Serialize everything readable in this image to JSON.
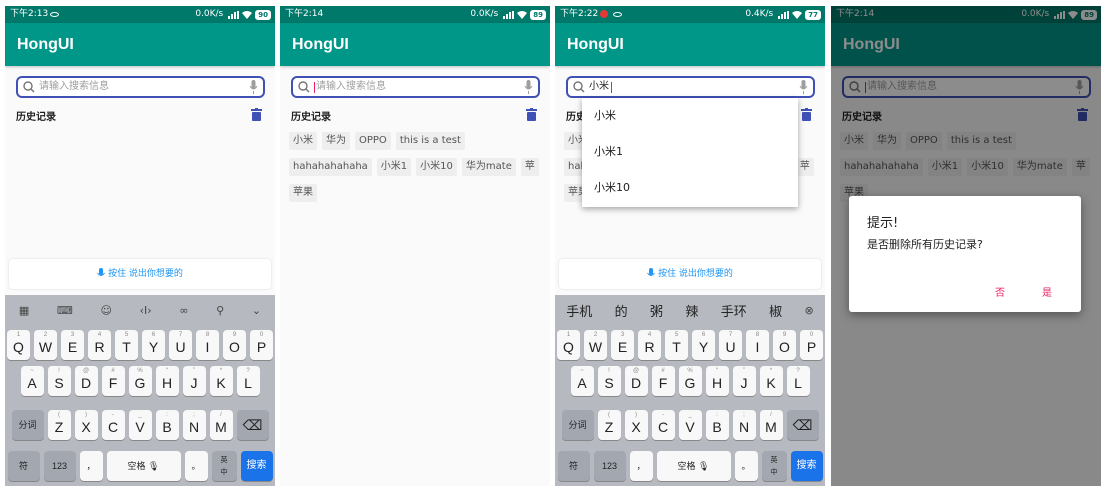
{
  "colors": {
    "primary_dark": "#00796b",
    "primary": "#009688",
    "accent": "#e91e63",
    "search_border": "#3f51b5",
    "keyboard_enter": "#1a73e8"
  },
  "screens": [
    {
      "status": {
        "time": "下午2:13",
        "net": "0.0K/s",
        "battery": "90"
      },
      "title": "HongUI",
      "search": {
        "placeholder": "请输入搜索信息",
        "value": ""
      },
      "history_title": "历史记录",
      "voice": "按住 说出你想要的",
      "keyboard_toolbar": [
        "grid-icon",
        "keyboard-icon",
        "emoji-icon",
        "cursor-icon",
        "link-icon",
        "search-icon",
        "chevron-down-icon"
      ]
    },
    {
      "status": {
        "time": "下午2:14",
        "net": "0.0K/s",
        "battery": "89"
      },
      "title": "HongUI",
      "search": {
        "placeholder": "请输入搜索信息",
        "value": ""
      },
      "history_title": "历史记录",
      "tags": [
        "小米",
        "华为",
        "OPPO",
        "this is a test",
        "hahahahahaha",
        "小米1",
        "小米10",
        "华为mate",
        "苹",
        "苹果"
      ]
    },
    {
      "status": {
        "time": "下午2:22",
        "net": "0.4K/s",
        "battery": "77"
      },
      "title": "HongUI",
      "search": {
        "placeholder": "请输入搜索信息",
        "value": "小米"
      },
      "history_title": "历史记录",
      "suggestions": [
        "小米",
        "小米1",
        "小米10"
      ],
      "voice": "按住 说出你想要的",
      "candidates": [
        "手机",
        "的",
        "粥",
        "辣",
        "手环",
        "椒"
      ]
    },
    {
      "status": {
        "time": "下午2:14",
        "net": "0.0K/s",
        "battery": "89"
      },
      "title": "HongUI",
      "search": {
        "placeholder": "请输入搜索信息",
        "value": ""
      },
      "history_title": "历史记录",
      "tags": [
        "小米",
        "华为",
        "OPPO",
        "this is a test",
        "hahahahahaha",
        "小米1",
        "小米10",
        "华为mate",
        "苹",
        "苹果"
      ],
      "dialog": {
        "title": "提示!",
        "message": "是否删除所有历史记录?",
        "negative": "否",
        "positive": "是"
      }
    }
  ],
  "keyboard": {
    "row1": [
      [
        "Q",
        "1"
      ],
      [
        "W",
        "2"
      ],
      [
        "E",
        "3"
      ],
      [
        "R",
        "4"
      ],
      [
        "T",
        "5"
      ],
      [
        "Y",
        "6"
      ],
      [
        "U",
        "7"
      ],
      [
        "I",
        "8"
      ],
      [
        "O",
        "9"
      ],
      [
        "P",
        "0"
      ]
    ],
    "row2": [
      [
        "A",
        "~"
      ],
      [
        "S",
        "!"
      ],
      [
        "D",
        "@"
      ],
      [
        "F",
        "#"
      ],
      [
        "G",
        "%"
      ],
      [
        "H",
        "“"
      ],
      [
        "J",
        "”"
      ],
      [
        "K",
        "*"
      ],
      [
        "L",
        "?"
      ]
    ],
    "row3": [
      [
        "Z",
        "("
      ],
      [
        "X",
        ")"
      ],
      [
        "C",
        "-"
      ],
      [
        "V",
        "_"
      ],
      [
        "B",
        ":"
      ],
      [
        "N",
        ";"
      ],
      [
        "M",
        "/"
      ]
    ],
    "fenci": "分词",
    "fu": "符",
    "num": "123",
    "comma": "，",
    "space": "空格",
    "period": "。",
    "lang_top": "英",
    "lang_bottom": "中",
    "enter": "搜索"
  }
}
